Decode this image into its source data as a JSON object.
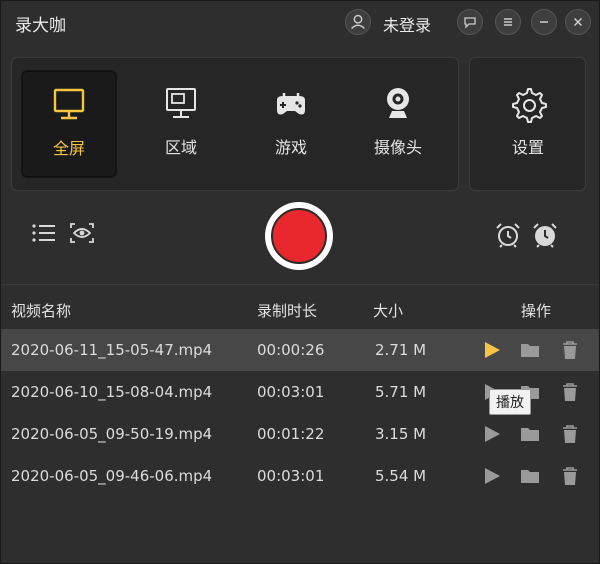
{
  "app": {
    "title": "录大咖",
    "login_status": "未登录"
  },
  "modes": [
    {
      "label": "全屏",
      "icon": "monitor-icon",
      "active": true
    },
    {
      "label": "区域",
      "icon": "region-monitor-icon",
      "active": false
    },
    {
      "label": "游戏",
      "icon": "gamepad-icon",
      "active": false
    },
    {
      "label": "摄像头",
      "icon": "webcam-icon",
      "active": false
    }
  ],
  "settings": {
    "label": "设置",
    "icon": "gear-icon"
  },
  "colors": {
    "accent": "#f5c543",
    "record": "#e8282c",
    "selected_row": "#474747"
  },
  "table": {
    "headers": {
      "name": "视频名称",
      "duration": "录制时长",
      "size": "大小",
      "actions": "操作"
    },
    "rows": [
      {
        "name": "2020-06-11_15-05-47.mp4",
        "duration": "00:00:26",
        "size": "2.71 M"
      },
      {
        "name": "2020-06-10_15-08-04.mp4",
        "duration": "00:03:01",
        "size": "5.71 M"
      },
      {
        "name": "2020-06-05_09-50-19.mp4",
        "duration": "00:01:22",
        "size": "3.15 M"
      },
      {
        "name": "2020-06-05_09-46-06.mp4",
        "duration": "00:03:01",
        "size": "5.54 M"
      }
    ]
  },
  "tooltip": {
    "text": "播放"
  }
}
